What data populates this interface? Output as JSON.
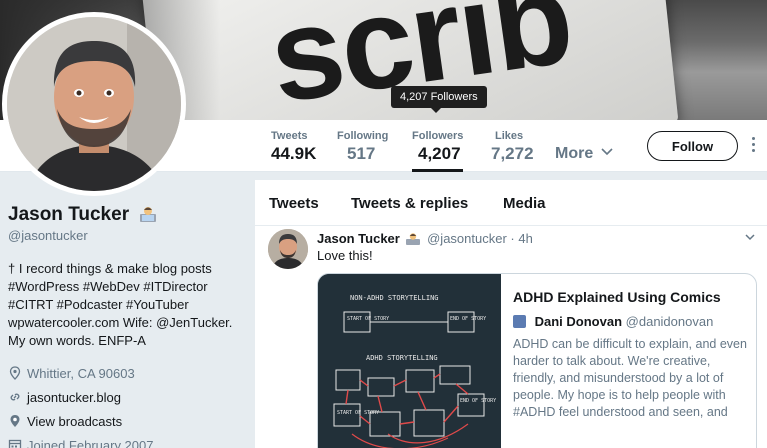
{
  "banner": {
    "logo_text": "scrib"
  },
  "tooltip": {
    "text": "4,207 Followers"
  },
  "nav": {
    "stats": [
      {
        "label": "Tweets",
        "value": "44.9K"
      },
      {
        "label": "Following",
        "value": "517"
      },
      {
        "label": "Followers",
        "value": "4,207"
      },
      {
        "label": "Likes",
        "value": "7,272"
      }
    ],
    "more_label": "More",
    "follow_label": "Follow"
  },
  "profile": {
    "name": "Jason Tucker",
    "handle": "@jasontucker",
    "bio_lines": [
      "† I record things & make blog posts",
      "#WordPress #WebDev #ITDirector",
      "#CITRT #Podcaster #YouTuber",
      "wpwatercooler.com Wife: @JenTucker.",
      "My own words. ENFP-A"
    ],
    "location": "Whittier, CA 90603",
    "website": "jasontucker.blog",
    "broadcasts": "View broadcasts",
    "joined": "Joined February 2007"
  },
  "timeline": {
    "tabs": [
      "Tweets",
      "Tweets & replies",
      "Media"
    ],
    "tweet": {
      "name": "Jason Tucker",
      "handle": "@jasontucker",
      "separator": "·",
      "time": "4h",
      "text": "Love this!",
      "card": {
        "title": "ADHD Explained Using Comics",
        "author_name": "Dani Donovan",
        "author_handle": "@danidonovan",
        "description": "ADHD can be difficult to explain, and even harder to talk about. We're creative, friendly, and misunderstood by a lot of people. My hope is to help people with #ADHD feel understood and seen, and",
        "image_labels": {
          "top_heading": "NON-ADHD STORYTELLING",
          "top_start": "START OF STORY",
          "top_end": "END OF STORY",
          "bottom_heading": "ADHD STORYTELLING",
          "bottom_start": "START OF STORY",
          "bottom_end": "END OF STORY"
        }
      }
    }
  },
  "colors": {
    "accent": "#1da1f2",
    "text": "#14171a",
    "muted": "#657786",
    "page_bg": "#e6ecf0"
  }
}
